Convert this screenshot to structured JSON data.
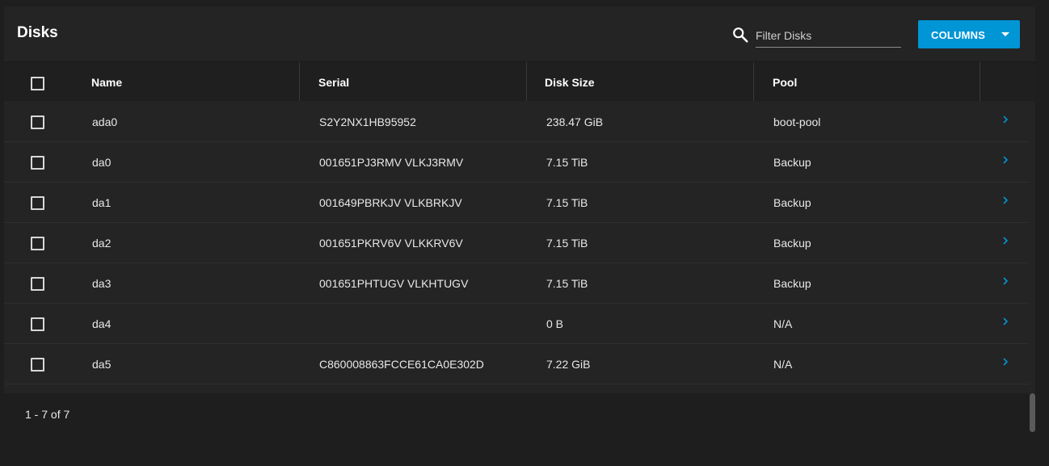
{
  "header": {
    "title": "Disks",
    "filter_placeholder": "Filter Disks",
    "filter_value": "",
    "columns_label": "COLUMNS"
  },
  "table": {
    "columns": [
      "Name",
      "Serial",
      "Disk Size",
      "Pool"
    ],
    "rows": [
      {
        "name": "ada0",
        "serial": "S2Y2NX1HB95952",
        "size": "238.47 GiB",
        "pool": "boot-pool"
      },
      {
        "name": "da0",
        "serial": "001651PJ3RMV VLKJ3RMV",
        "size": "7.15 TiB",
        "pool": "Backup"
      },
      {
        "name": "da1",
        "serial": "001649PBRKJV VLKBRKJV",
        "size": "7.15 TiB",
        "pool": "Backup"
      },
      {
        "name": "da2",
        "serial": "001651PKRV6V VLKKRV6V",
        "size": "7.15 TiB",
        "pool": "Backup"
      },
      {
        "name": "da3",
        "serial": "001651PHTUGV VLKHTUGV",
        "size": "7.15 TiB",
        "pool": "Backup"
      },
      {
        "name": "da4",
        "serial": "",
        "size": "0 B",
        "pool": "N/A"
      },
      {
        "name": "da5",
        "serial": "C860008863FCCE61CA0E302D",
        "size": "7.22 GiB",
        "pool": "N/A"
      }
    ]
  },
  "footer": {
    "range_label": "1 - 7 of 7"
  },
  "colors": {
    "accent": "#0095d5",
    "background": "#1e1e1e",
    "card": "#242424"
  }
}
